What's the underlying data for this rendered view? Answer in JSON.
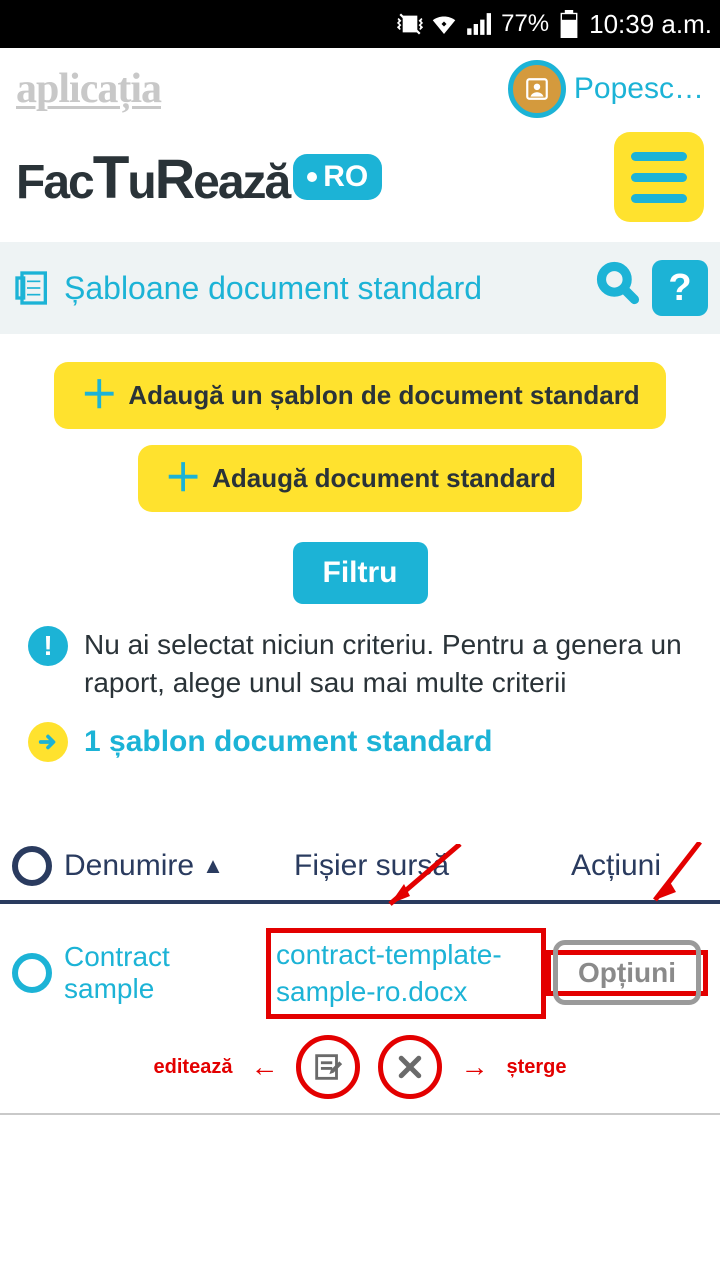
{
  "status": {
    "battery": "77%",
    "time": "10:39 a.m."
  },
  "header": {
    "app_tag": "aplicația",
    "user_name": "Popesc…",
    "brand_text": "FacTuReazĂ",
    "brand_badge": "RO"
  },
  "page": {
    "title": "Șabloane document standard",
    "help": "?",
    "add_template": "Adaugă un șablon de document standard",
    "add_doc": "Adaugă document standard",
    "filter": "Filtru",
    "no_criteria": "Nu ai selectat niciun criteriu. Pentru a genera un raport, alege unul sau mai multe criterii",
    "count_text": "1 șablon document standard"
  },
  "table": {
    "col_name": "Denumire",
    "col_file": "Fișier sursă",
    "col_actions": "Acțiuni",
    "row": {
      "name": "Contract sample",
      "file": "contract-template-sample-ro.docx",
      "options": "Opțiuni"
    }
  },
  "annotations": {
    "edit": "editează",
    "delete": "șterge"
  }
}
